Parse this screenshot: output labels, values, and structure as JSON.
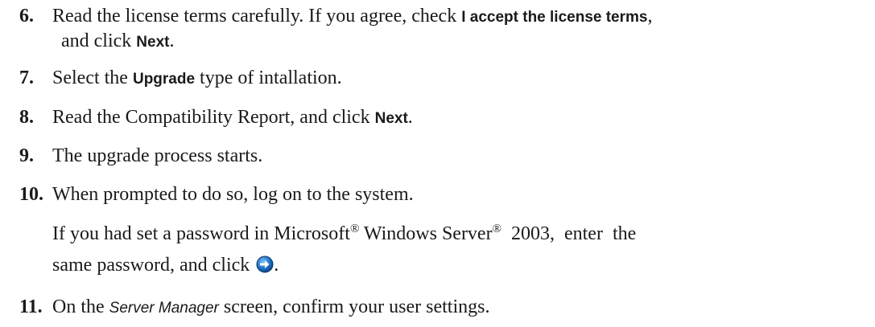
{
  "steps": [
    {
      "number": "6.",
      "line1_a": "Read the license terms carefully. If you agree, check ",
      "line1_ui": "I accept the license terms",
      "line1_b": ",",
      "line2_a": "and click ",
      "line2_ui": "Next",
      "line2_b": "."
    },
    {
      "number": "7.",
      "a": "Select the ",
      "ui": "Upgrade",
      "b": " type of intallation."
    },
    {
      "number": "8.",
      "a": "Read the Compatibility Report, and click ",
      "ui": "Next",
      "b": "."
    },
    {
      "number": "9.",
      "text": "The upgrade process starts."
    },
    {
      "number": "10.",
      "text": "When prompted to do so, log on to the system.",
      "sub_line1_a": "If you had set a password in Microsoft",
      "sub_line1_reg1": "®",
      "sub_line1_b": " Windows Server",
      "sub_line1_reg2": "®",
      "sub_line1_c": " 2003, enter the",
      "sub_line2_a": "same password, and click ",
      "sub_line2_b": "."
    },
    {
      "number": "11.",
      "a": "On the ",
      "ital": "Server Manager",
      "b": " screen, confirm your user settings."
    }
  ],
  "icons": {
    "go_arrow": "go-arrow-icon"
  },
  "colors": {
    "text": "#1a1a1a",
    "icon_blue": "#1f6fc4"
  }
}
